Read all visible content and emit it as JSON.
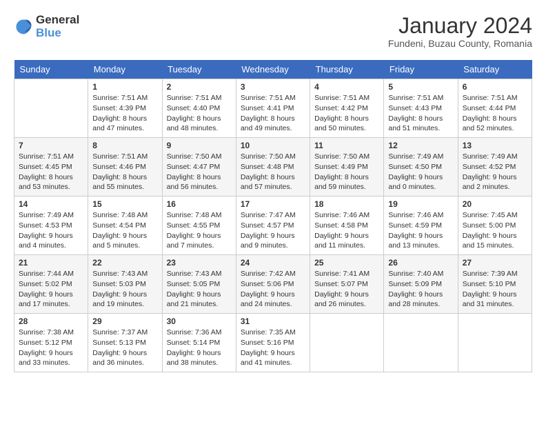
{
  "logo": {
    "general": "General",
    "blue": "Blue"
  },
  "title": "January 2024",
  "subtitle": "Fundeni, Buzau County, Romania",
  "headers": [
    "Sunday",
    "Monday",
    "Tuesday",
    "Wednesday",
    "Thursday",
    "Friday",
    "Saturday"
  ],
  "weeks": [
    [
      {
        "day": "",
        "sunrise": "",
        "sunset": "",
        "daylight": ""
      },
      {
        "day": "1",
        "sunrise": "Sunrise: 7:51 AM",
        "sunset": "Sunset: 4:39 PM",
        "daylight": "Daylight: 8 hours and 47 minutes."
      },
      {
        "day": "2",
        "sunrise": "Sunrise: 7:51 AM",
        "sunset": "Sunset: 4:40 PM",
        "daylight": "Daylight: 8 hours and 48 minutes."
      },
      {
        "day": "3",
        "sunrise": "Sunrise: 7:51 AM",
        "sunset": "Sunset: 4:41 PM",
        "daylight": "Daylight: 8 hours and 49 minutes."
      },
      {
        "day": "4",
        "sunrise": "Sunrise: 7:51 AM",
        "sunset": "Sunset: 4:42 PM",
        "daylight": "Daylight: 8 hours and 50 minutes."
      },
      {
        "day": "5",
        "sunrise": "Sunrise: 7:51 AM",
        "sunset": "Sunset: 4:43 PM",
        "daylight": "Daylight: 8 hours and 51 minutes."
      },
      {
        "day": "6",
        "sunrise": "Sunrise: 7:51 AM",
        "sunset": "Sunset: 4:44 PM",
        "daylight": "Daylight: 8 hours and 52 minutes."
      }
    ],
    [
      {
        "day": "7",
        "sunrise": "Sunrise: 7:51 AM",
        "sunset": "Sunset: 4:45 PM",
        "daylight": "Daylight: 8 hours and 53 minutes."
      },
      {
        "day": "8",
        "sunrise": "Sunrise: 7:51 AM",
        "sunset": "Sunset: 4:46 PM",
        "daylight": "Daylight: 8 hours and 55 minutes."
      },
      {
        "day": "9",
        "sunrise": "Sunrise: 7:50 AM",
        "sunset": "Sunset: 4:47 PM",
        "daylight": "Daylight: 8 hours and 56 minutes."
      },
      {
        "day": "10",
        "sunrise": "Sunrise: 7:50 AM",
        "sunset": "Sunset: 4:48 PM",
        "daylight": "Daylight: 8 hours and 57 minutes."
      },
      {
        "day": "11",
        "sunrise": "Sunrise: 7:50 AM",
        "sunset": "Sunset: 4:49 PM",
        "daylight": "Daylight: 8 hours and 59 minutes."
      },
      {
        "day": "12",
        "sunrise": "Sunrise: 7:49 AM",
        "sunset": "Sunset: 4:50 PM",
        "daylight": "Daylight: 9 hours and 0 minutes."
      },
      {
        "day": "13",
        "sunrise": "Sunrise: 7:49 AM",
        "sunset": "Sunset: 4:52 PM",
        "daylight": "Daylight: 9 hours and 2 minutes."
      }
    ],
    [
      {
        "day": "14",
        "sunrise": "Sunrise: 7:49 AM",
        "sunset": "Sunset: 4:53 PM",
        "daylight": "Daylight: 9 hours and 4 minutes."
      },
      {
        "day": "15",
        "sunrise": "Sunrise: 7:48 AM",
        "sunset": "Sunset: 4:54 PM",
        "daylight": "Daylight: 9 hours and 5 minutes."
      },
      {
        "day": "16",
        "sunrise": "Sunrise: 7:48 AM",
        "sunset": "Sunset: 4:55 PM",
        "daylight": "Daylight: 9 hours and 7 minutes."
      },
      {
        "day": "17",
        "sunrise": "Sunrise: 7:47 AM",
        "sunset": "Sunset: 4:57 PM",
        "daylight": "Daylight: 9 hours and 9 minutes."
      },
      {
        "day": "18",
        "sunrise": "Sunrise: 7:46 AM",
        "sunset": "Sunset: 4:58 PM",
        "daylight": "Daylight: 9 hours and 11 minutes."
      },
      {
        "day": "19",
        "sunrise": "Sunrise: 7:46 AM",
        "sunset": "Sunset: 4:59 PM",
        "daylight": "Daylight: 9 hours and 13 minutes."
      },
      {
        "day": "20",
        "sunrise": "Sunrise: 7:45 AM",
        "sunset": "Sunset: 5:00 PM",
        "daylight": "Daylight: 9 hours and 15 minutes."
      }
    ],
    [
      {
        "day": "21",
        "sunrise": "Sunrise: 7:44 AM",
        "sunset": "Sunset: 5:02 PM",
        "daylight": "Daylight: 9 hours and 17 minutes."
      },
      {
        "day": "22",
        "sunrise": "Sunrise: 7:43 AM",
        "sunset": "Sunset: 5:03 PM",
        "daylight": "Daylight: 9 hours and 19 minutes."
      },
      {
        "day": "23",
        "sunrise": "Sunrise: 7:43 AM",
        "sunset": "Sunset: 5:05 PM",
        "daylight": "Daylight: 9 hours and 21 minutes."
      },
      {
        "day": "24",
        "sunrise": "Sunrise: 7:42 AM",
        "sunset": "Sunset: 5:06 PM",
        "daylight": "Daylight: 9 hours and 24 minutes."
      },
      {
        "day": "25",
        "sunrise": "Sunrise: 7:41 AM",
        "sunset": "Sunset: 5:07 PM",
        "daylight": "Daylight: 9 hours and 26 minutes."
      },
      {
        "day": "26",
        "sunrise": "Sunrise: 7:40 AM",
        "sunset": "Sunset: 5:09 PM",
        "daylight": "Daylight: 9 hours and 28 minutes."
      },
      {
        "day": "27",
        "sunrise": "Sunrise: 7:39 AM",
        "sunset": "Sunset: 5:10 PM",
        "daylight": "Daylight: 9 hours and 31 minutes."
      }
    ],
    [
      {
        "day": "28",
        "sunrise": "Sunrise: 7:38 AM",
        "sunset": "Sunset: 5:12 PM",
        "daylight": "Daylight: 9 hours and 33 minutes."
      },
      {
        "day": "29",
        "sunrise": "Sunrise: 7:37 AM",
        "sunset": "Sunset: 5:13 PM",
        "daylight": "Daylight: 9 hours and 36 minutes."
      },
      {
        "day": "30",
        "sunrise": "Sunrise: 7:36 AM",
        "sunset": "Sunset: 5:14 PM",
        "daylight": "Daylight: 9 hours and 38 minutes."
      },
      {
        "day": "31",
        "sunrise": "Sunrise: 7:35 AM",
        "sunset": "Sunset: 5:16 PM",
        "daylight": "Daylight: 9 hours and 41 minutes."
      },
      {
        "day": "",
        "sunrise": "",
        "sunset": "",
        "daylight": ""
      },
      {
        "day": "",
        "sunrise": "",
        "sunset": "",
        "daylight": ""
      },
      {
        "day": "",
        "sunrise": "",
        "sunset": "",
        "daylight": ""
      }
    ]
  ]
}
